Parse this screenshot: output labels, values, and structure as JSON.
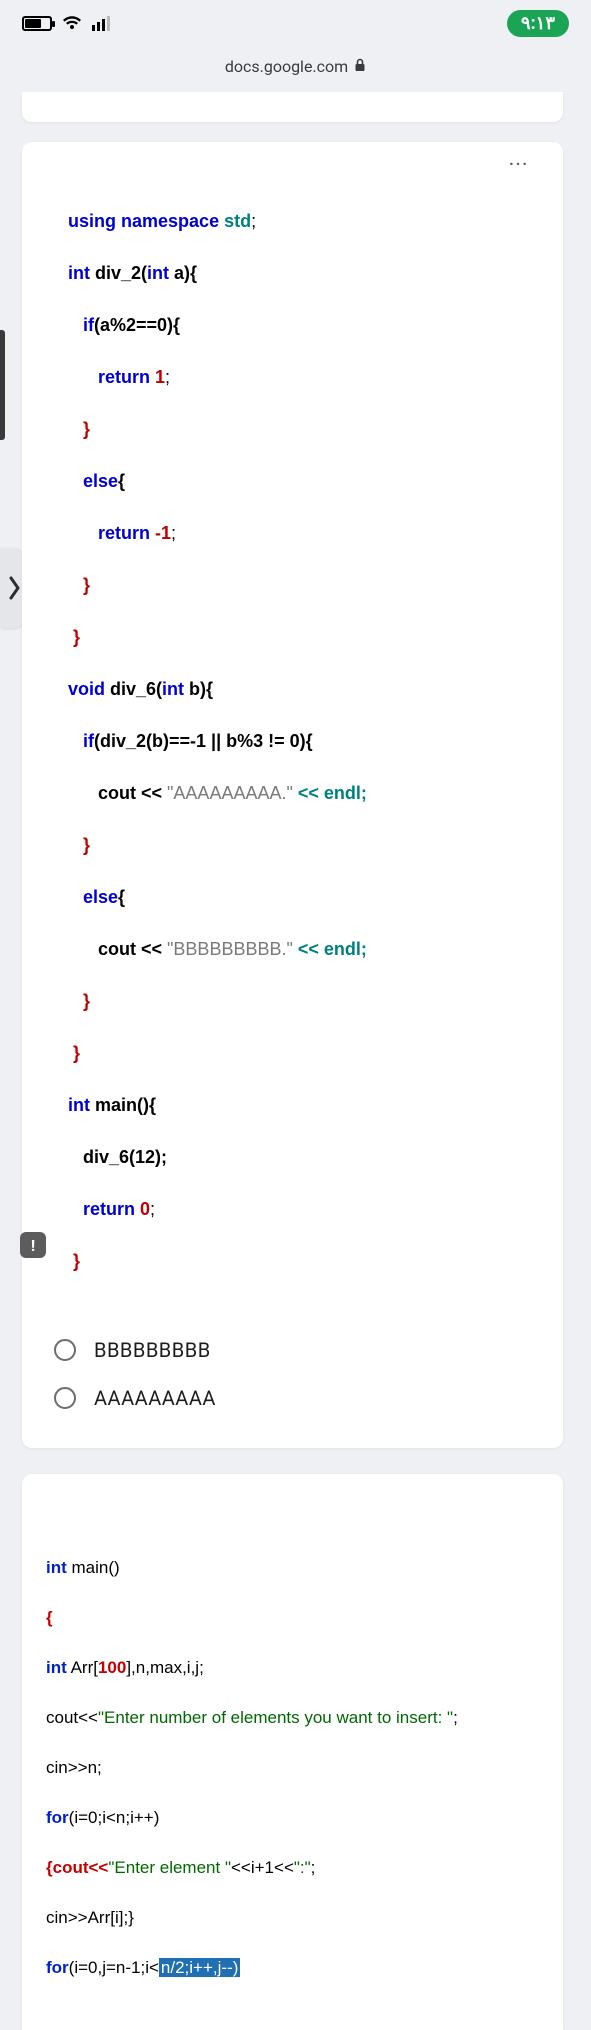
{
  "statusbar": {
    "clock": "٩:١٣"
  },
  "omnibar": {
    "url": "docs.google.com"
  },
  "question1": {
    "code": {
      "l1a": "using",
      "l1b": "namespace",
      "l1c": "std",
      "l1d": ";",
      "l2a": "int",
      "l2b": " div_2(",
      "l2c": "int",
      "l2d": " a){",
      "l3a": "   if",
      "l3b": "(a%2==0){",
      "l4a": "      return ",
      "l4b": "1",
      "l4c": ";",
      "l5": "   }",
      "l6a": "   else",
      "l6b": "{",
      "l7a": "      return ",
      "l7b": "-1",
      "l7c": ";",
      "l8": "   }",
      "l9": " }",
      "l10a": "void",
      "l10b": " div_6(",
      "l10c": "int",
      "l10d": " b){",
      "l11a": "   if",
      "l11b": "(div_2(b)==-1 || b%3 != 0){",
      "l12a": "      cout << ",
      "l12b": "\"AAAAAAAAA.\"",
      "l12c": " << endl;",
      "l13": "   }",
      "l14a": "   else",
      "l14b": "{",
      "l15a": "      cout << ",
      "l15b": "\"BBBBBBBBB.\"",
      "l15c": " << endl;",
      "l16": "   }",
      "l17": " }",
      "l18a": "int",
      "l18b": " main(){",
      "l19": "   div_6(12);",
      "l20a": "   return ",
      "l20b": "0",
      "l20c": ";",
      "l21": " }"
    },
    "optionA": "BBBBBBBBB",
    "optionB": "AAAAAAAAA"
  },
  "question2": {
    "code": {
      "l1a": "int",
      "l1b": " main()",
      "l2": "{",
      "l3a": "int",
      "l3b": " Arr[",
      "l3c": "100",
      "l3d": "],n,max,i,j;",
      "l4a": "cout<<",
      "l4b": "\"Enter number of elements you want to insert: \"",
      "l4c": ";",
      "l5a": "cin>>n;",
      "l6a": "for",
      "l6b": "(i=0;i<n;i++)",
      "l7a": "{cout<<",
      "l7b": "\"Enter element \"",
      "l7c": "<<i+1<<",
      "l7d": "\":\"",
      "l7e": ";",
      "l8": "cin>>Arr[i];}",
      "l9a": "for",
      "l9b": "(i=0,j=n-1;i<",
      "l9c": "n/2;i++,j--)"
    }
  }
}
